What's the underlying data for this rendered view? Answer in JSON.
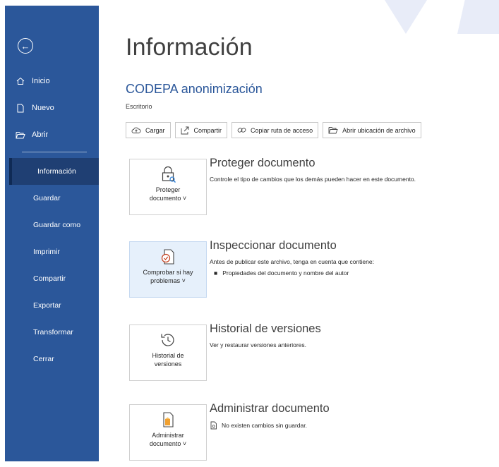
{
  "sidebar": {
    "back_icon": "arrow-left-icon",
    "top_items": [
      {
        "label": "Inicio",
        "icon": "home-icon"
      },
      {
        "label": "Nuevo",
        "icon": "new-document-icon"
      },
      {
        "label": "Abrir",
        "icon": "folder-open-icon"
      }
    ],
    "items": [
      {
        "label": "Información",
        "active": true
      },
      {
        "label": "Guardar"
      },
      {
        "label": "Guardar como"
      },
      {
        "label": "Imprimir"
      },
      {
        "label": "Compartir"
      },
      {
        "label": "Exportar"
      },
      {
        "label": "Transformar"
      },
      {
        "label": "Cerrar"
      }
    ]
  },
  "main": {
    "page_title": "Información",
    "document_title": "CODEPA anonimización",
    "document_location": "Escritorio",
    "toolbar": [
      {
        "label": "Cargar",
        "icon": "cloud-upload-icon"
      },
      {
        "label": "Compartir",
        "icon": "share-icon"
      },
      {
        "label": "Copiar ruta de acceso",
        "icon": "link-icon"
      },
      {
        "label": "Abrir ubicación de archivo",
        "icon": "folder-open-icon"
      }
    ],
    "sections": [
      {
        "button_label": "Proteger\ndocumento ˅",
        "icon": "lock-icon",
        "title": "Proteger documento",
        "description": "Controle el tipo de cambios que los demás pueden hacer en este documento."
      },
      {
        "button_label": "Comprobar si hay\nproblemas ˅",
        "icon": "inspect-document-icon",
        "title": "Inspeccionar documento",
        "description": "Antes de publicar este archivo, tenga en cuenta que contiene:",
        "bullet": "Propiedades del documento y nombre del autor"
      },
      {
        "button_label": "Historial de\nversiones",
        "icon": "history-icon",
        "title": "Historial de versiones",
        "description": "Ver y restaurar versiones anteriores."
      },
      {
        "button_label": "Administrar\ndocumento ˅",
        "icon": "manage-document-icon",
        "title": "Administrar documento",
        "status": "No existen cambios sin guardar."
      }
    ]
  },
  "colors": {
    "sidebar": "#2b579a",
    "sidebar_active": "#1f3f73",
    "accent": "#2b579a",
    "highlight": "#e6f0fb"
  }
}
